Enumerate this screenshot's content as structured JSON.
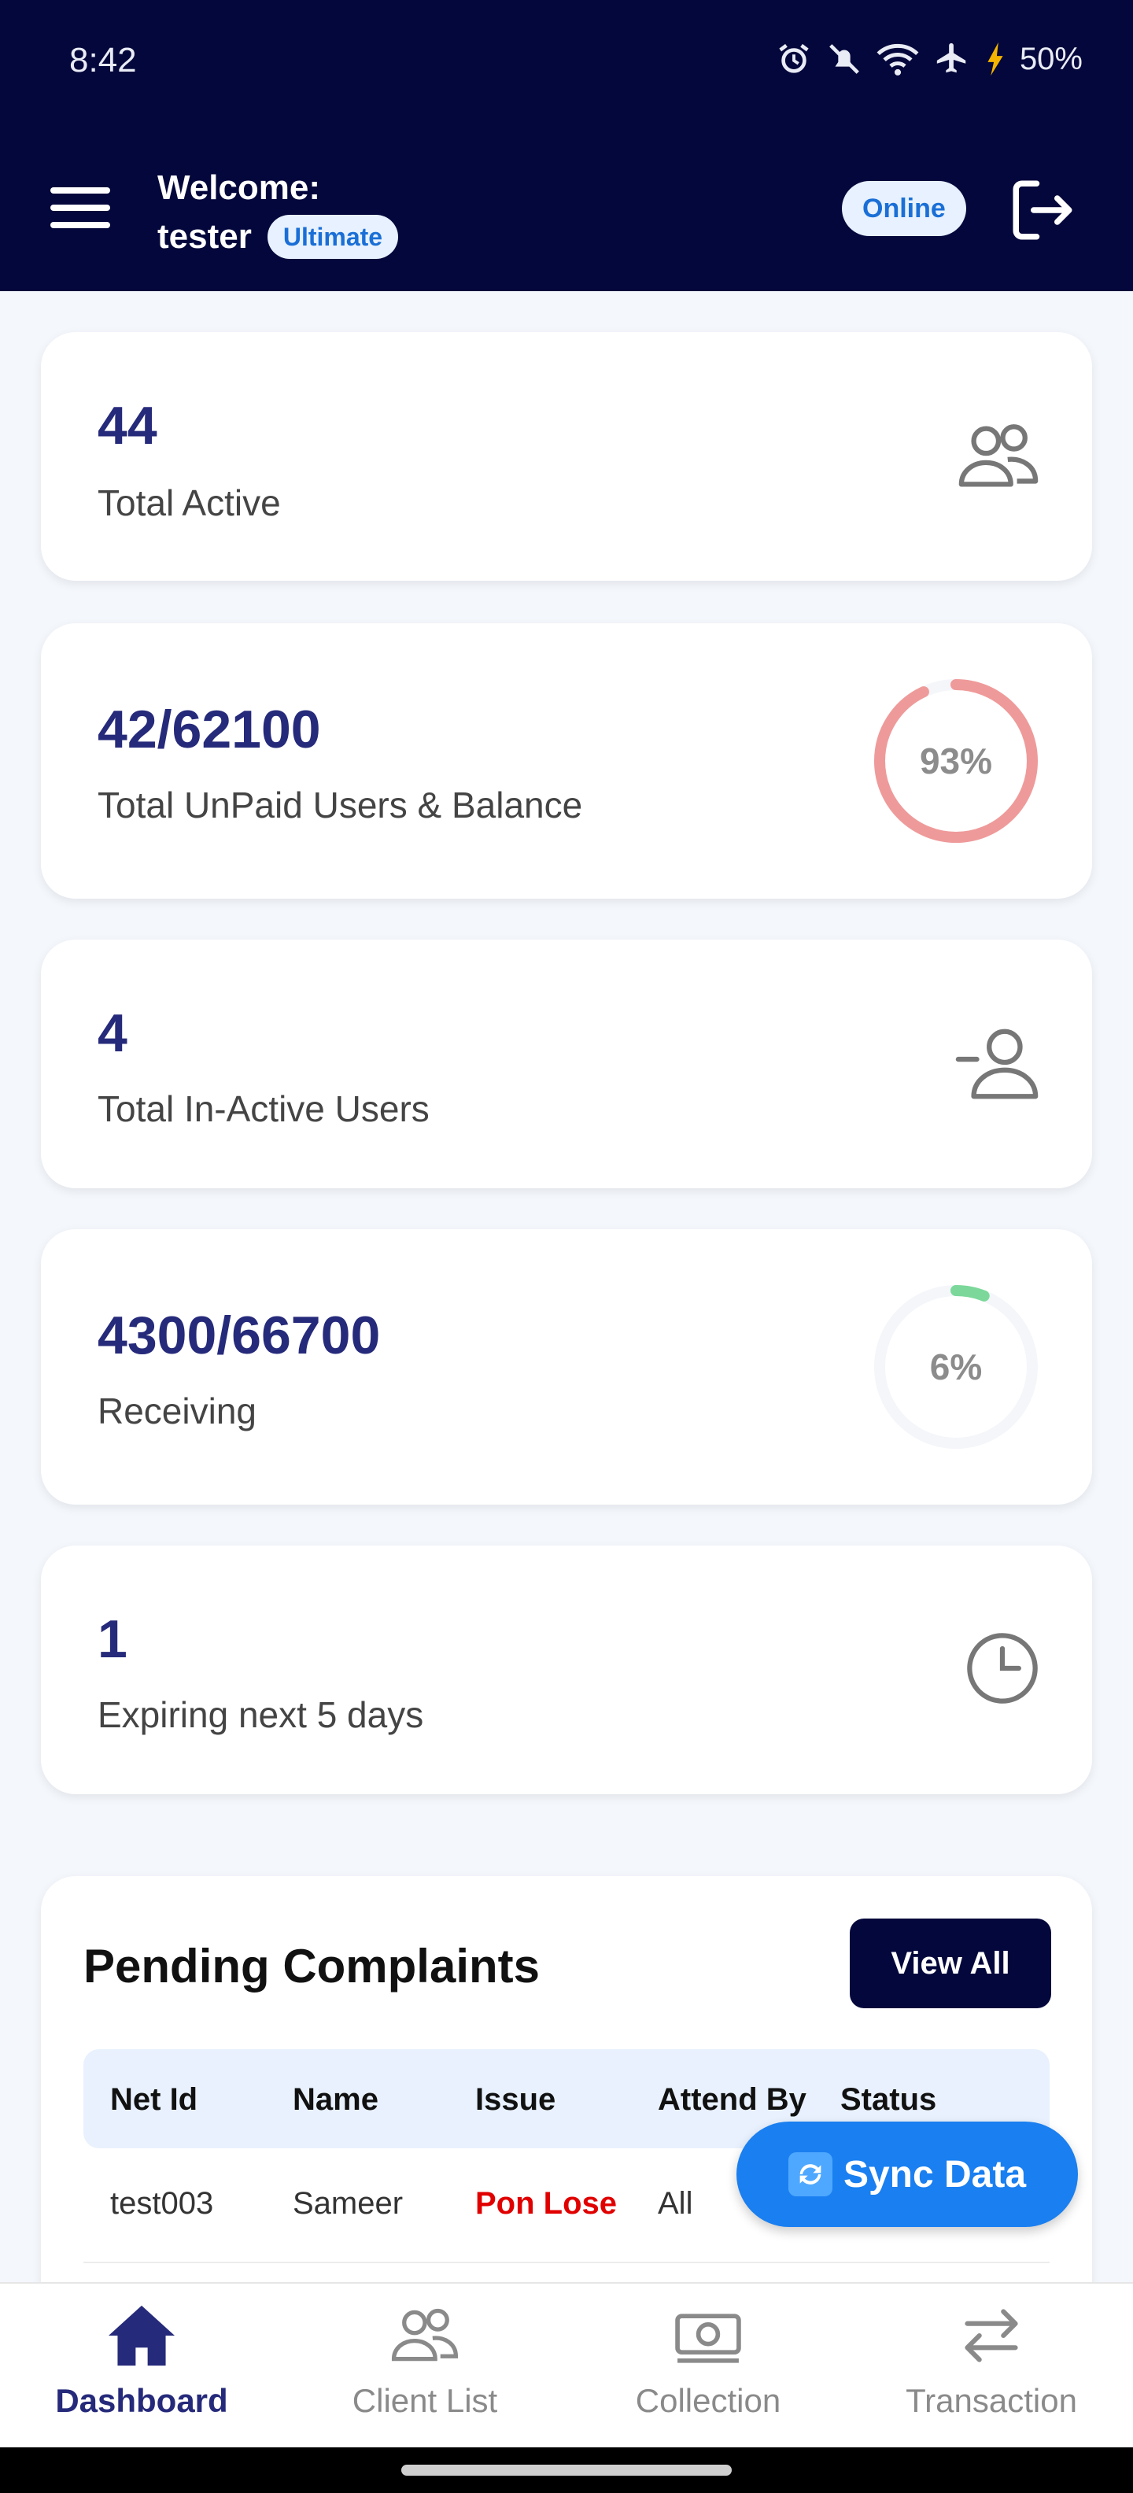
{
  "status_bar": {
    "time": "8:42",
    "battery": "50%"
  },
  "header": {
    "welcome_label": "Welcome:",
    "username": "tester",
    "plan": "Ultimate",
    "online_status": "Online"
  },
  "cards": {
    "active": {
      "value": "44",
      "label": "Total Active"
    },
    "unpaid": {
      "value": "42/62100",
      "label": "Total UnPaid Users & Balance",
      "percent_text": "93%",
      "percent": 93,
      "color": "#ef9a9a"
    },
    "inactive": {
      "value": "4",
      "label": "Total In-Active Users"
    },
    "receiving": {
      "value": "4300/66700",
      "label": "Receiving",
      "percent_text": "6%",
      "percent": 6,
      "color": "#7bd89a"
    },
    "expiring": {
      "value": "1",
      "label": "Expiring next 5 days"
    }
  },
  "complaints": {
    "title": "Pending Complaints",
    "view_all_label": "View All",
    "columns": [
      "Net Id",
      "Name",
      "Issue",
      "Attend By",
      "Status"
    ],
    "rows": [
      {
        "net_id": "test003",
        "name": "Sameer",
        "issue": "Pon Lose",
        "attend_by": "All",
        "status": ""
      }
    ]
  },
  "sync_button": {
    "label": "Sync Data"
  },
  "bottom_nav": [
    {
      "label": "Dashboard",
      "icon": "home-icon",
      "active": true
    },
    {
      "label": "Client List",
      "icon": "users-icon",
      "active": false
    },
    {
      "label": "Collection",
      "icon": "cash-icon",
      "active": false
    },
    {
      "label": "Transaction",
      "icon": "transfer-icon",
      "active": false
    }
  ]
}
